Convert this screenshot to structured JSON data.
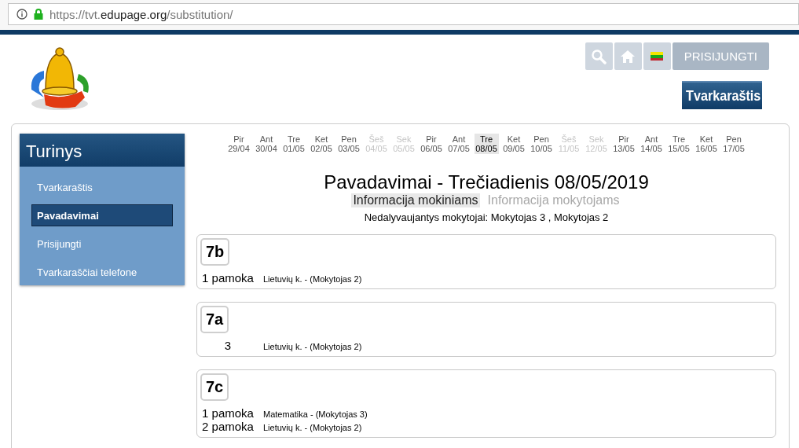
{
  "address_bar": {
    "url_prefix": "https://tvt.",
    "url_domain": "edupage.org",
    "url_path": "/substitution/"
  },
  "header": {
    "icon_buttons": [
      {
        "kind": "search"
      },
      {
        "kind": "home"
      },
      {
        "kind": "flag"
      }
    ],
    "login_button": "PRISIJUNGTI",
    "schedule_button": "Tvarkaraštis"
  },
  "sidebar": {
    "title": "Turinys",
    "items": [
      {
        "label": "Tvarkaraštis",
        "selected": false
      },
      {
        "label": "Pavadavimai",
        "selected": true
      },
      {
        "label": "Prisijungti",
        "selected": false
      },
      {
        "label": "Tvarkaraščiai telefone",
        "selected": false
      }
    ]
  },
  "days": [
    {
      "day": "Pir",
      "date": "29/04",
      "dimmed": false,
      "selected": false
    },
    {
      "day": "Ant",
      "date": "30/04",
      "dimmed": false,
      "selected": false
    },
    {
      "day": "Tre",
      "date": "01/05",
      "dimmed": false,
      "selected": false
    },
    {
      "day": "Ket",
      "date": "02/05",
      "dimmed": false,
      "selected": false
    },
    {
      "day": "Pen",
      "date": "03/05",
      "dimmed": false,
      "selected": false
    },
    {
      "day": "Šeš",
      "date": "04/05",
      "dimmed": true,
      "selected": false
    },
    {
      "day": "Sek",
      "date": "05/05",
      "dimmed": true,
      "selected": false
    },
    {
      "day": "Pir",
      "date": "06/05",
      "dimmed": false,
      "selected": false
    },
    {
      "day": "Ant",
      "date": "07/05",
      "dimmed": false,
      "selected": false
    },
    {
      "day": "Tre",
      "date": "08/05",
      "dimmed": false,
      "selected": true
    },
    {
      "day": "Ket",
      "date": "09/05",
      "dimmed": false,
      "selected": false
    },
    {
      "day": "Pen",
      "date": "10/05",
      "dimmed": false,
      "selected": false
    },
    {
      "day": "Šeš",
      "date": "11/05",
      "dimmed": true,
      "selected": false
    },
    {
      "day": "Sek",
      "date": "12/05",
      "dimmed": true,
      "selected": false
    },
    {
      "day": "Pir",
      "date": "13/05",
      "dimmed": false,
      "selected": false
    },
    {
      "day": "Ant",
      "date": "14/05",
      "dimmed": false,
      "selected": false
    },
    {
      "day": "Tre",
      "date": "15/05",
      "dimmed": false,
      "selected": false
    },
    {
      "day": "Ket",
      "date": "16/05",
      "dimmed": false,
      "selected": false
    },
    {
      "day": "Pen",
      "date": "17/05",
      "dimmed": false,
      "selected": false
    }
  ],
  "title": "Pavadavimai - Trečiadienis 08/05/2019",
  "tabs": [
    {
      "label": "Informacija mokiniams",
      "selected": true
    },
    {
      "label": "Informacija mokytojams",
      "selected": false
    }
  ],
  "absent_teachers": "Nedalyvaujantys mokytojai: Mokytojas 3 , Mokytojas 2",
  "classes": [
    {
      "name": "7b",
      "lessons": [
        {
          "period": "1 pamoka",
          "info": "Lietuvių k. - (Mokytojas 2)"
        }
      ]
    },
    {
      "name": "7a",
      "lessons": [
        {
          "period": "3",
          "info": "Lietuvių k. - (Mokytojas 2)"
        }
      ]
    },
    {
      "name": "7c",
      "lessons": [
        {
          "period": "1 pamoka",
          "info": "Matematika - (Mokytojas 3)"
        },
        {
          "period": "2 pamoka",
          "info": "Lietuvių k. - (Mokytojas 2)"
        }
      ]
    }
  ]
}
